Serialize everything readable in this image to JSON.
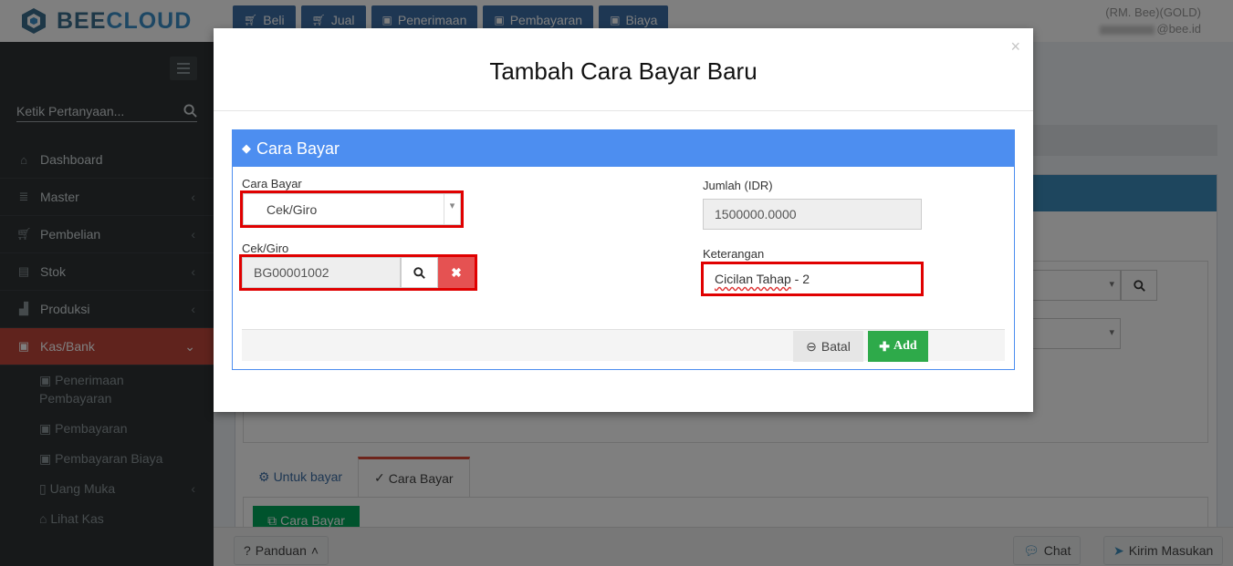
{
  "app": {
    "logo_part1": "BEE",
    "logo_part2": "CLOUD",
    "brand_color": "#3a8fc9"
  },
  "topnav": [
    {
      "label": "Beli",
      "icon": "cart-icon"
    },
    {
      "label": "Jual",
      "icon": "cart-icon"
    },
    {
      "label": "Penerimaan",
      "icon": "money-icon"
    },
    {
      "label": "Pembayaran",
      "icon": "money-icon"
    },
    {
      "label": "Biaya",
      "icon": "money-icon"
    }
  ],
  "user": {
    "company": "(RM. Bee)(GOLD)",
    "email_suffix": "@bee.id"
  },
  "sidebar": {
    "search_placeholder": "Ketik Pertanyaan...",
    "items": [
      {
        "label": "Dashboard",
        "icon": "home-icon"
      },
      {
        "label": "Master",
        "icon": "database-icon"
      },
      {
        "label": "Pembelian",
        "icon": "cart-icon"
      },
      {
        "label": "Stok",
        "icon": "box-icon"
      },
      {
        "label": "Produksi",
        "icon": "industry-icon"
      },
      {
        "label": "Kas/Bank",
        "icon": "money-icon",
        "active": true
      }
    ],
    "subitems": [
      {
        "label": "Penerimaan Pembayaran",
        "icon": "money-icon"
      },
      {
        "label": "Pembayaran",
        "icon": "money-icon"
      },
      {
        "label": "Pembayaran Biaya",
        "icon": "money-icon"
      },
      {
        "label": "Uang Muka",
        "icon": "file-icon"
      },
      {
        "label": "Lihat Kas",
        "icon": "bank-icon"
      }
    ]
  },
  "page": {
    "tabs": [
      "Untuk bayar",
      "Cara Bayar"
    ],
    "cara_bayar_button": "Cara Bayar"
  },
  "footer": {
    "panduan": "Panduan",
    "chat": "Chat",
    "kirim": "Kirim Masukan"
  },
  "modal": {
    "title": "Tambah Cara Bayar Baru",
    "close": "×",
    "box_title": "Cara Bayar",
    "cara_bayar_label": "Cara Bayar",
    "cara_bayar_value": "Cek/Giro",
    "cekgiro_label": "Cek/Giro",
    "cekgiro_value": "BG00001002",
    "jumlah_label": "Jumlah (IDR)",
    "jumlah_value": "1500000.0000",
    "keterangan_label": "Keterangan",
    "keterangan_value_underlined": "Cicilan Tahap",
    "keterangan_value_rest": " - 2",
    "batal": "Batal",
    "add": "Add",
    "accent_color": "#4d8ef0",
    "highlight_color": "#e00000"
  }
}
